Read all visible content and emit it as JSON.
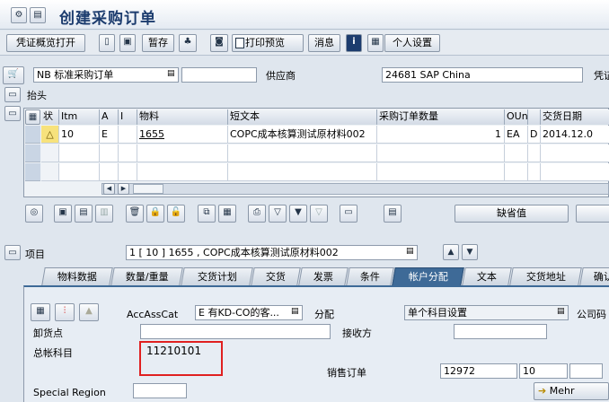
{
  "title": "创建采购订单",
  "toolbar": {
    "overview_button": "凭证概览打开",
    "hold_button": "暂存",
    "print_preview_button": "打印预览",
    "messages_button": "消息",
    "personal_settings_button": "个人设置"
  },
  "header": {
    "order_type": "NB 标准采购订单",
    "vendor_label": "供应商",
    "vendor_value": "24681  SAP China",
    "doc_date_label_partial": "凭证",
    "section_header_label": "抬头"
  },
  "items_table": {
    "columns": [
      "状",
      "Itm",
      "A",
      "I",
      "物料",
      "短文本",
      "采购订单数量",
      "OUn",
      "",
      "交货日期"
    ],
    "rows": [
      {
        "status": "△",
        "item": "10",
        "acct": "E",
        "cat": "",
        "material": "1655",
        "short_text": "COPC成本核算测试原材料002",
        "quantity": "1",
        "unit": "EA",
        "d": "D",
        "delivery_date": "2014.12.0"
      }
    ]
  },
  "default_value_button": "缺省值",
  "item_section": {
    "label": "项目",
    "selector": "1 [ 10 ] 1655 , COPC成本核算测试原材料002"
  },
  "tabs": [
    "物料数据",
    "数量/重量",
    "交货计划",
    "交货",
    "发票",
    "条件",
    "帐户分配",
    "文本",
    "交货地址",
    "确认"
  ],
  "active_tab": "帐户分配",
  "account_assignment": {
    "acc_ass_cat_label": "AccAssCat",
    "acc_ass_cat_value": "E 有KD-CO的客...",
    "distribution_label": "分配",
    "distribution_value": "单个科目设置",
    "company_code_label_partial": "公司码",
    "unloading_point_label": "卸货点",
    "recipient_label": "接收方",
    "gl_account_label": "总帐科目",
    "gl_account_value": "11210101",
    "sales_order_label": "销售订单",
    "sales_order_value": "12972",
    "sales_order_item": "10",
    "special_region_label": "Special Region",
    "more_button": "Mehr"
  },
  "colors": {
    "title": "#1c3c6e",
    "highlight_box": "#e02020",
    "tab_active": "#3e6a97"
  }
}
